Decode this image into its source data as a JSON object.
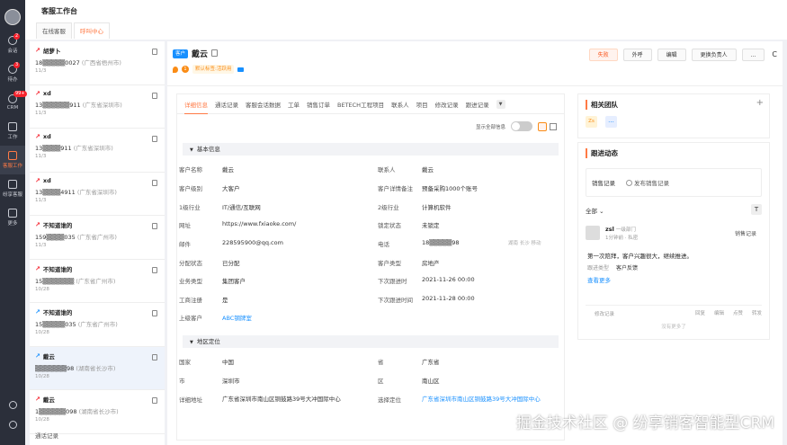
{
  "rail": {
    "items": [
      {
        "label": "会话",
        "badge": "2"
      },
      {
        "label": "待办",
        "badge": "3"
      },
      {
        "label": "CRM",
        "badge": "99+"
      },
      {
        "label": "工作",
        "badge": ""
      },
      {
        "label": "客服工作",
        "badge": ""
      },
      {
        "label": "纷享客服",
        "badge": ""
      },
      {
        "label": "更多",
        "badge": ""
      }
    ]
  },
  "header": {
    "title": "客服工作台",
    "tabs": [
      "在线客服",
      "呼叫中心"
    ]
  },
  "calls": [
    {
      "name": "胡萝卜",
      "direction": "out",
      "phone": "18▒▒▒▒▒0027",
      "loc": "(广西省梧州市)",
      "date": "11/3"
    },
    {
      "name": "xd",
      "direction": "out",
      "phone": "13▒▒▒▒▒▒911",
      "loc": "(广东省深圳市)",
      "date": "11/3"
    },
    {
      "name": "xd",
      "direction": "out",
      "phone": "13▒▒▒▒911",
      "loc": "(广东省深圳市)",
      "date": "11/3"
    },
    {
      "name": "xd",
      "direction": "out",
      "phone": "13▒▒▒▒4911",
      "loc": "(广东省深圳市)",
      "date": "11/3"
    },
    {
      "name": "不知道谁的",
      "direction": "out",
      "phone": "159▒▒▒▒035",
      "loc": "(广东省广州市)",
      "date": "11/3"
    },
    {
      "name": "不知道谁的",
      "direction": "out",
      "phone": "15▒▒▒▒▒▒▒",
      "loc": "(广东省广州市)",
      "date": "10/28"
    },
    {
      "name": "不知道谁的",
      "direction": "in",
      "phone": "15▒▒▒▒▒035",
      "loc": "(广东省广州市)",
      "date": "10/28"
    },
    {
      "name": "戴云",
      "direction": "in",
      "phone": "▒▒▒▒▒▒▒98",
      "loc": "(湖南省长沙市)",
      "date": "10/28"
    },
    {
      "name": "戴云",
      "direction": "out",
      "phone": "1▒▒▒▒▒▒098",
      "loc": "(湖南省长沙市)",
      "date": "10/28"
    }
  ],
  "list_footer": "通话记录",
  "customer": {
    "tag": "客户",
    "name": "戴云",
    "coin": "1",
    "label": "默认标签:活跃用",
    "buttons": [
      "失败",
      "外呼",
      "编辑",
      "更换负责人",
      "...",
      "C"
    ]
  },
  "tabs": [
    "详细信息",
    "通话记录",
    "客服会话数据",
    "工单",
    "销售订单",
    "BETECH工程项目",
    "联系人",
    "项目",
    "修改记录",
    "跟进记录"
  ],
  "toggle_label": "显示全部信息",
  "basic_title": "基本信息",
  "fields_left": [
    {
      "k": "客户名称",
      "v": "戴云"
    },
    {
      "k": "客户级别",
      "v": "大客户"
    },
    {
      "k": "1级行业",
      "v": "IT/通信/互联网"
    },
    {
      "k": "网址",
      "v": "https://www.fxiaoke.com/"
    },
    {
      "k": "邮件",
      "v": "228595900@qq.com"
    },
    {
      "k": "分配状态",
      "v": "已分配"
    },
    {
      "k": "业务类型",
      "v": "集团客户"
    },
    {
      "k": "工商注册",
      "v": "是"
    },
    {
      "k": "上级客户",
      "v": "ABC钢牌室"
    }
  ],
  "fields_right": [
    {
      "k": "联系人",
      "v": "戴云"
    },
    {
      "k": "客户详情备注",
      "v": "预备采购1000个账号"
    },
    {
      "k": "2级行业",
      "v": "计算机软件"
    },
    {
      "k": "锁定状态",
      "v": "未锁定"
    },
    {
      "k": "电话",
      "v": "18▒▒▒▒▒98",
      "extra": "湖南 长沙 移动"
    },
    {
      "k": "客户类型",
      "v": "房地产"
    },
    {
      "k": "下次跟进时",
      "v": "2021-11-26 00:00"
    },
    {
      "k": "下次跟进时间",
      "v": "2021-11-28 00:00"
    }
  ],
  "geo_title": "地区定位",
  "geo_left": [
    {
      "k": "国家",
      "v": "中国"
    },
    {
      "k": "市",
      "v": "深圳市"
    },
    {
      "k": "详细地址",
      "v": "广东省深圳市南山区铜鼓路39号大冲国际中心"
    }
  ],
  "geo_right": [
    {
      "k": "省",
      "v": "广东省"
    },
    {
      "k": "区",
      "v": "南山区"
    },
    {
      "k": "选择定位",
      "v": "广东省深圳市南山区铜鼓路39号大冲国际中心"
    }
  ],
  "team": {
    "title": "相关团队",
    "member": "Zs",
    "more": "..."
  },
  "follow": {
    "title": "跟进动态",
    "type": "销售记录",
    "publish": "发布销售记录",
    "filter": "全部",
    "user": "zsl",
    "dept": "一级部门",
    "time": "1分钟前 · 私密",
    "rec_type": "销售记录",
    "content": "第一次陪拜，客户兴趣很大，继续推进。",
    "key": "跟进类型",
    "val": "客户反馈",
    "more": "查看更多",
    "footer_label": "修改记录",
    "actions": [
      "回复",
      "编辑",
      "点赞",
      "转发"
    ],
    "end": "没有更多了"
  },
  "watermark": "掘金技术社区 @ 纷享销客智能型CRM"
}
